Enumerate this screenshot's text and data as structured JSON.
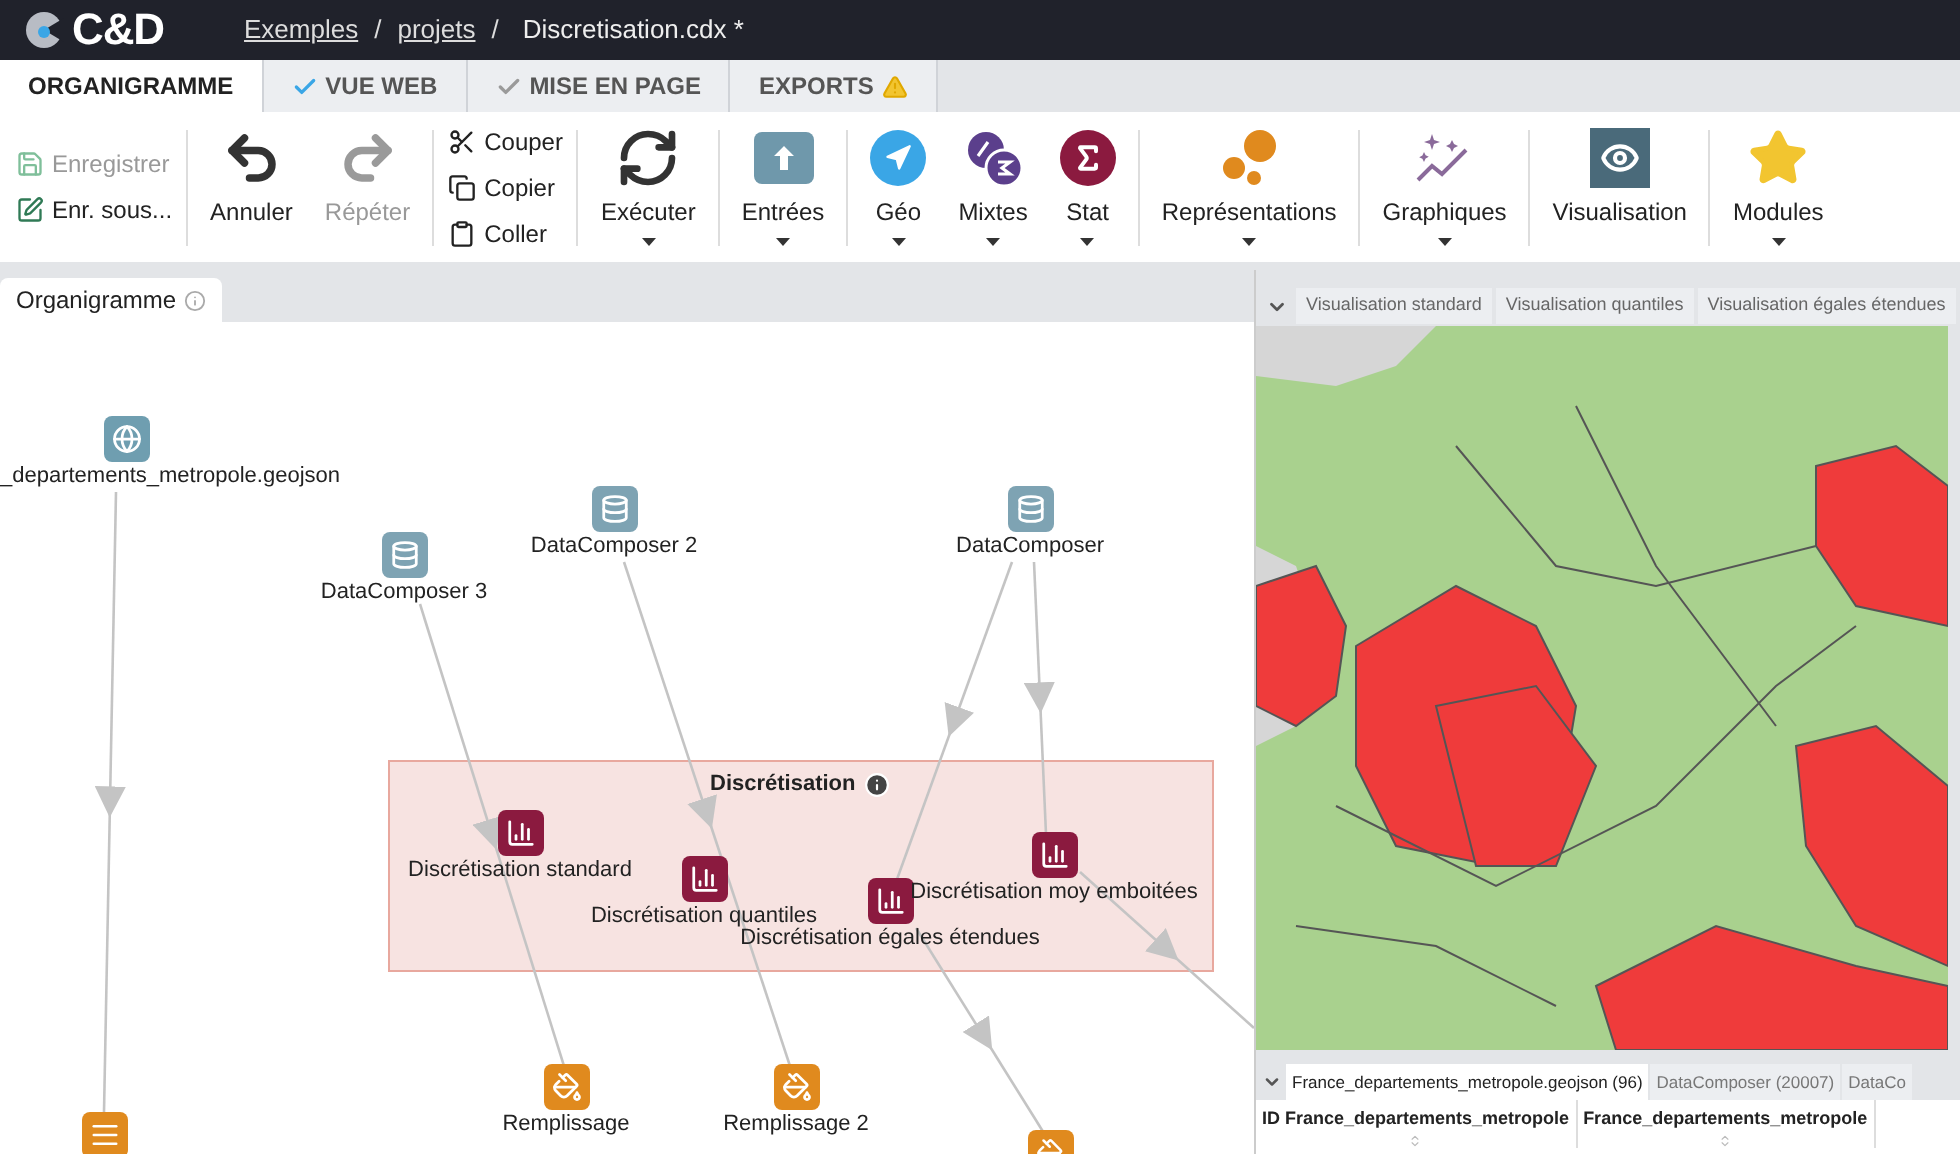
{
  "header": {
    "logo": "C&D",
    "breadcrumbs": [
      {
        "label": "Exemples",
        "kind": "link"
      },
      {
        "label": "/",
        "kind": "separator"
      },
      {
        "label": "projets",
        "kind": "link"
      },
      {
        "label": "/",
        "kind": "separator"
      },
      {
        "label": "Discretisation.cdx *",
        "kind": "current"
      }
    ]
  },
  "tabs": [
    {
      "label": "ORGANIGRAMME",
      "selected": true,
      "kind": "plain"
    },
    {
      "label": "VUE WEB",
      "selected": false,
      "kind": "valid"
    },
    {
      "label": "MISE EN PAGE",
      "selected": false,
      "kind": "muted"
    },
    {
      "label": "EXPORTS",
      "selected": false,
      "kind": "warning"
    }
  ],
  "toolbar": [
    {
      "kind": "stack",
      "items": [
        {
          "label": "Enregistrer",
          "disabled": true
        },
        {
          "label": "Enr. sous...",
          "disabled": false
        }
      ]
    },
    {
      "kind": "large",
      "items": [
        {
          "label": "Annuler",
          "disabled": false,
          "dropdown": false
        },
        {
          "label": "Répéter",
          "disabled": true,
          "dropdown": false
        }
      ]
    },
    {
      "kind": "stack",
      "items": [
        {
          "label": "Couper",
          "disabled": false
        },
        {
          "label": "Copier",
          "disabled": false
        },
        {
          "label": "Coller",
          "disabled": false
        }
      ]
    },
    {
      "kind": "large",
      "items": [
        {
          "label": "Exécuter",
          "disabled": false,
          "dropdown": true
        }
      ]
    },
    {
      "kind": "large",
      "items": [
        {
          "label": "Entrées",
          "disabled": false,
          "dropdown": true
        }
      ]
    },
    {
      "kind": "large",
      "items": [
        {
          "label": "Géo",
          "disabled": false,
          "dropdown": true
        },
        {
          "label": "Mixtes",
          "disabled": false,
          "dropdown": true
        },
        {
          "label": "Stat",
          "disabled": false,
          "dropdown": true
        }
      ]
    },
    {
      "kind": "large",
      "items": [
        {
          "label": "Représentations",
          "disabled": false,
          "dropdown": true
        }
      ]
    },
    {
      "kind": "large",
      "items": [
        {
          "label": "Graphiques",
          "disabled": false,
          "dropdown": true
        }
      ]
    },
    {
      "kind": "large",
      "items": [
        {
          "label": "Visualisation",
          "disabled": false,
          "dropdown": false
        }
      ]
    },
    {
      "kind": "large",
      "items": [
        {
          "label": "Modules",
          "disabled": false,
          "dropdown": true
        }
      ]
    }
  ],
  "diagram": {
    "tab": "Organigramme",
    "group": {
      "title": "Discrétisation"
    },
    "nodes": [
      {
        "label": "_departements_metropole.geojson",
        "kind": "source"
      },
      {
        "label": "DataComposer 3",
        "kind": "composer"
      },
      {
        "label": "DataComposer 2",
        "kind": "composer"
      },
      {
        "label": "DataComposer",
        "kind": "composer"
      },
      {
        "label": "Discrétisation standard",
        "kind": "discretisation"
      },
      {
        "label": "Discrétisation quantiles",
        "kind": "discretisation"
      },
      {
        "label": "Discrétisation égales étendues",
        "kind": "discretisation"
      },
      {
        "label": "Discrétisation moy emboitées",
        "kind": "discretisation"
      },
      {
        "label": "Remplissage",
        "kind": "fill"
      },
      {
        "label": "Remplissage 2",
        "kind": "fill"
      }
    ]
  },
  "views": {
    "tabs": [
      {
        "label": "Visualisation standard",
        "selected": false
      },
      {
        "label": "Visualisation quantiles",
        "selected": false
      },
      {
        "label": "Visualisation égales étendues",
        "selected": false
      }
    ]
  },
  "data_panel": {
    "tabs": [
      {
        "label": "France_departements_metropole.geojson (96)",
        "selected": true
      },
      {
        "label": "DataComposer (20007)",
        "selected": false
      },
      {
        "label": "DataCo",
        "selected": false
      }
    ],
    "columns": [
      "ID France_departements_metropole",
      "France_departements_metropole"
    ]
  }
}
